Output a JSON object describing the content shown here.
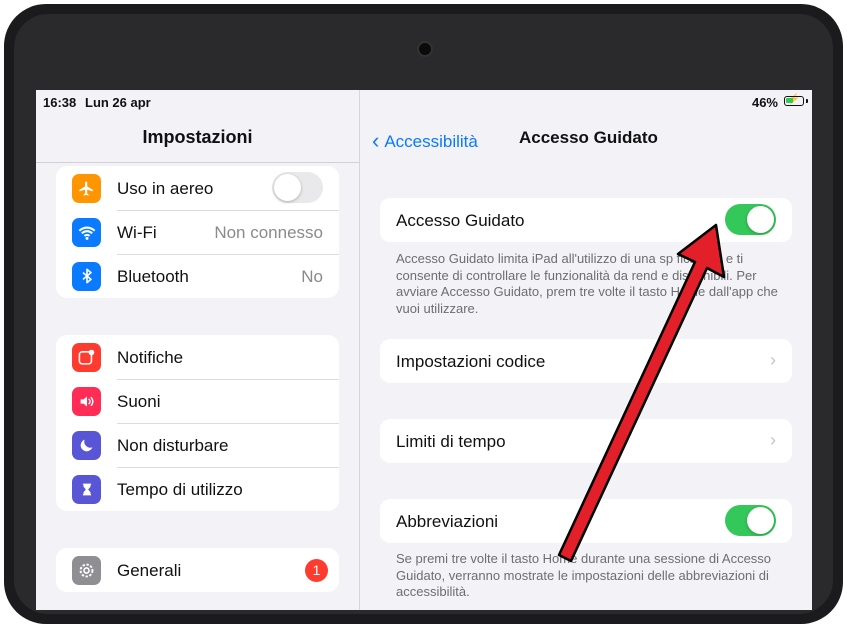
{
  "status": {
    "time": "16:38",
    "date": "Lun 26 apr",
    "battery": "46%",
    "battery_level": 0.46
  },
  "sidebar": {
    "title": "Impostazioni",
    "groups": [
      [
        {
          "label": "Uso in aereo",
          "icon": "airplane-icon",
          "color": "#ff9500",
          "toggle": false
        },
        {
          "label": "Wi-Fi",
          "value": "Non connesso",
          "icon": "wifi-icon",
          "color": "#0a7aff"
        },
        {
          "label": "Bluetooth",
          "value": "No",
          "icon": "bluetooth-icon",
          "color": "#0a7aff"
        }
      ],
      [
        {
          "label": "Notifiche",
          "icon": "notifications-icon",
          "color": "#ff3b30"
        },
        {
          "label": "Suoni",
          "icon": "speaker-icon",
          "color": "#ff2d55"
        },
        {
          "label": "Non disturbare",
          "icon": "moon-icon",
          "color": "#5856d6"
        },
        {
          "label": "Tempo di utilizzo",
          "icon": "hourglass-icon",
          "color": "#5856d6"
        }
      ],
      [
        {
          "label": "Generali",
          "icon": "gear-icon",
          "color": "#8e8e93",
          "badge": "1"
        }
      ]
    ]
  },
  "detail": {
    "back_label": "Accessibilità",
    "title": "Accesso Guidato",
    "guided_access": {
      "label": "Accesso Guidato",
      "enabled": true
    },
    "guided_footnote": "Accesso Guidato limita iPad all'utilizzo di una sp  fica app e ti consente di controllare le funzionalità da rend  e disponibili. Per avviare Accesso Guidato, prem  tre volte il tasto Home dall'app che vuoi utilizzare.",
    "passcode_settings": "Impostazioni codice",
    "time_limits": "Limiti di tempo",
    "shortcuts": {
      "label": "Abbreviazioni",
      "enabled": true
    },
    "shortcuts_footnote": "Se premi tre volte il tasto Home durante una sessione di Accesso Guidato, verranno mostrate le impostazioni delle abbreviazioni di accessibilità."
  },
  "colors": {
    "accent": "#0a7aff",
    "switch_on": "#34c759",
    "arrow": "#e3202a"
  }
}
